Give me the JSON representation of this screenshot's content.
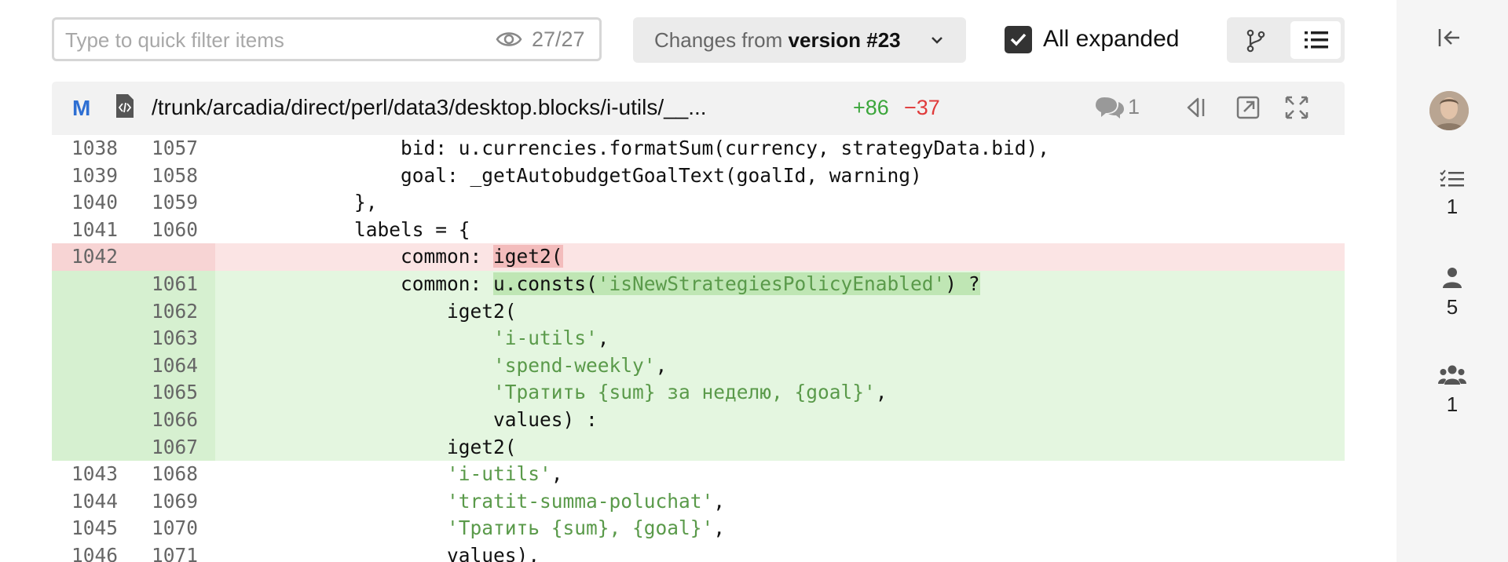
{
  "toolbar": {
    "filter_placeholder": "Type to quick filter items",
    "filter_count": "27/27",
    "version_prefix": "Changes from ",
    "version_value": "version #23",
    "expand_label": "All expanded",
    "expand_checked": true
  },
  "file": {
    "badge": "M",
    "path": "/trunk/arcadia/direct/perl/data3/desktop.blocks/i-utils/__...",
    "added": "+86",
    "removed": "−37",
    "comments": "1"
  },
  "diff": [
    {
      "type": "ctx",
      "old": "1038",
      "new": "1057",
      "segments": [
        {
          "t": "                bid: u.currencies.formatSum(currency, strategyData.bid),"
        }
      ]
    },
    {
      "type": "ctx",
      "old": "1039",
      "new": "1058",
      "segments": [
        {
          "t": "                goal: _getAutobudgetGoalText(goalId, warning)"
        }
      ]
    },
    {
      "type": "ctx",
      "old": "1040",
      "new": "1059",
      "segments": [
        {
          "t": "            },"
        }
      ]
    },
    {
      "type": "ctx",
      "old": "1041",
      "new": "1060",
      "segments": [
        {
          "t": "            labels = {"
        }
      ]
    },
    {
      "type": "del",
      "old": "1042",
      "new": "",
      "segments": [
        {
          "t": "                common: "
        },
        {
          "t": "iget2(",
          "c": "hl-del"
        }
      ]
    },
    {
      "type": "add",
      "old": "",
      "new": "1061",
      "segments": [
        {
          "t": "                common: "
        },
        {
          "t": "u.consts(",
          "c": "hl-add"
        },
        {
          "t": "'isNewStrategiesPolicyEnabled'",
          "c": "hl-add str"
        },
        {
          "t": ") ?",
          "c": "hl-add"
        }
      ]
    },
    {
      "type": "add",
      "old": "",
      "new": "1062",
      "segments": [
        {
          "t": "                    iget2("
        }
      ]
    },
    {
      "type": "add",
      "old": "",
      "new": "1063",
      "segments": [
        {
          "t": "                        "
        },
        {
          "t": "'i-utils'",
          "c": "str"
        },
        {
          "t": ","
        }
      ]
    },
    {
      "type": "add",
      "old": "",
      "new": "1064",
      "segments": [
        {
          "t": "                        "
        },
        {
          "t": "'spend-weekly'",
          "c": "str"
        },
        {
          "t": ","
        }
      ]
    },
    {
      "type": "add",
      "old": "",
      "new": "1065",
      "segments": [
        {
          "t": "                        "
        },
        {
          "t": "'Тратить {sum} за неделю, {goal}'",
          "c": "str"
        },
        {
          "t": ","
        }
      ]
    },
    {
      "type": "add",
      "old": "",
      "new": "1066",
      "segments": [
        {
          "t": "                        values) :"
        }
      ]
    },
    {
      "type": "add",
      "old": "",
      "new": "1067",
      "segments": [
        {
          "t": "                    iget2("
        }
      ]
    },
    {
      "type": "ctx",
      "old": "1043",
      "new": "1068",
      "segments": [
        {
          "t": "                    "
        },
        {
          "t": "'i-utils'",
          "c": "str"
        },
        {
          "t": ","
        }
      ]
    },
    {
      "type": "ctx",
      "old": "1044",
      "new": "1069",
      "segments": [
        {
          "t": "                    "
        },
        {
          "t": "'tratit-summa-poluchat'",
          "c": "str"
        },
        {
          "t": ","
        }
      ]
    },
    {
      "type": "ctx",
      "old": "1045",
      "new": "1070",
      "segments": [
        {
          "t": "                    "
        },
        {
          "t": "'Тратить {sum}, {goal}'",
          "c": "str"
        },
        {
          "t": ","
        }
      ]
    },
    {
      "type": "ctx",
      "old": "1046",
      "new": "1071",
      "segments": [
        {
          "t": "                    values),"
        }
      ]
    }
  ],
  "sidebar": {
    "tasks_count": "1",
    "reviewers_count": "5",
    "groups_count": "1"
  },
  "colors": {
    "added": "#3ca63c",
    "removed": "#e03b3b",
    "badge": "#2e6fd3",
    "string": "#5a9a4a"
  }
}
